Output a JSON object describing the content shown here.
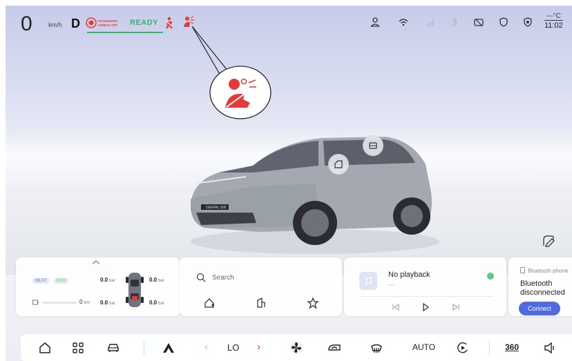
{
  "status_bar": {
    "speed": "0",
    "speed_unit": "km/h",
    "gear": "D",
    "airbag_label": "PASSENGER AIRBAG OFF",
    "ready": "READY",
    "temperature": "---°C",
    "time": "11:02"
  },
  "energy_card": {
    "tag_wltp": "WLTP",
    "tag_eco": "ECO",
    "range_value": "0",
    "range_unit": "km",
    "tire_fl": "0.0",
    "tire_fr": "0.0",
    "tire_rl": "0.0",
    "tire_rr": "0.0",
    "tire_unit": "bar"
  },
  "nav_card": {
    "search_placeholder": "Search"
  },
  "music_card": {
    "title": "No playback",
    "subtitle": "---"
  },
  "bluetooth_card": {
    "label": "Bluetooth phone",
    "status": "Bluetooth disconnected",
    "connect_label": "Connect"
  },
  "dock": {
    "fan_level": "LO",
    "auto_label": "AUTO",
    "view_360_label": "360"
  },
  "colors": {
    "ready_green": "#36b36a",
    "alert_red": "#e63a3a",
    "connect_blue": "#4f6be0"
  }
}
